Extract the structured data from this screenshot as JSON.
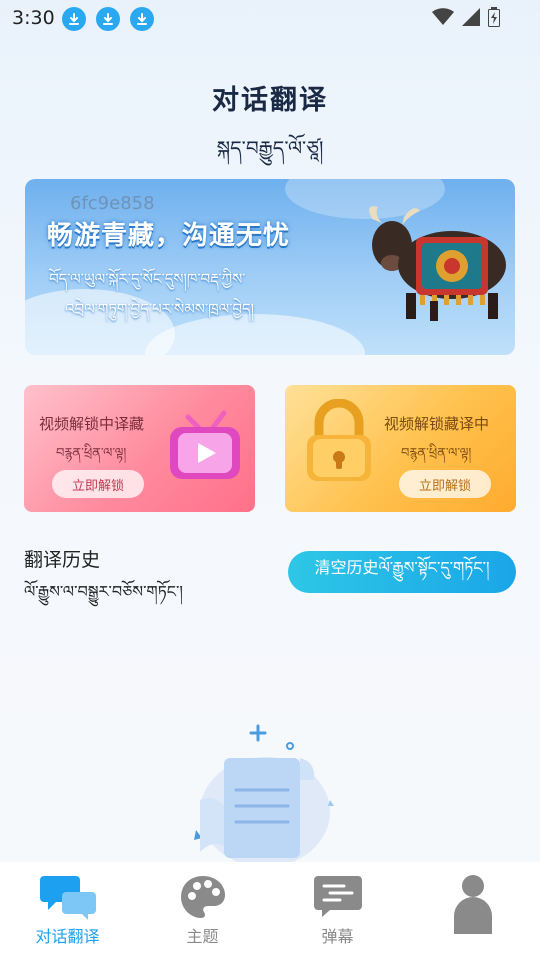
{
  "status_bar": {
    "time": "3:30"
  },
  "header": {
    "title": "对话翻译",
    "subtitle_tibetan": "སྐད་བརྒྱུད་ལོ་ཙཱ།"
  },
  "banner": {
    "code": "6fc9e858",
    "slogan": "畅游青藏，沟通无忧",
    "tibetan_line1": "བོད་ལ་ཡུལ་སྐོར་དུ་སོང་དུས།ཁ་བརྡ་ཀྱིས་",
    "tibetan_line2": "འབྲེལ་གཏུག་བྱེད་པར་སེམས་ཁྲལ་བྱེད།"
  },
  "cards": [
    {
      "title": "视频解锁中译藏",
      "tibetan": "བརྙན་ཕྲིན་ལ་ལྟ།",
      "button": "立即解锁"
    },
    {
      "title": "视频解锁藏译中",
      "tibetan": "བརྙན་ཕྲིན་ལ་ལྟ།",
      "button": "立即解锁"
    }
  ],
  "history": {
    "title": "翻译历史",
    "title_tibetan": "ལོ་རྒྱུས་ལ་བསྒྱུར་བཅོས་གཏོང་།",
    "clear_label": "清空历史ལོ་རྒྱུས་སྟོང་དུ་གཏོང་།"
  },
  "tabbar": {
    "items": [
      {
        "label": "对话翻译",
        "icon": "chat-bubbles-icon",
        "active": true
      },
      {
        "label": "主题",
        "icon": "palette-icon",
        "active": false
      },
      {
        "label": "弹幕",
        "icon": "danmaku-icon",
        "active": false
      },
      {
        "label": "",
        "icon": "person-icon",
        "active": false
      }
    ]
  },
  "colors": {
    "accent": "#1ea0f0",
    "clear_button": "#22b6e8",
    "card_left": "#ff8b9e",
    "card_right": "#ffc14d"
  }
}
